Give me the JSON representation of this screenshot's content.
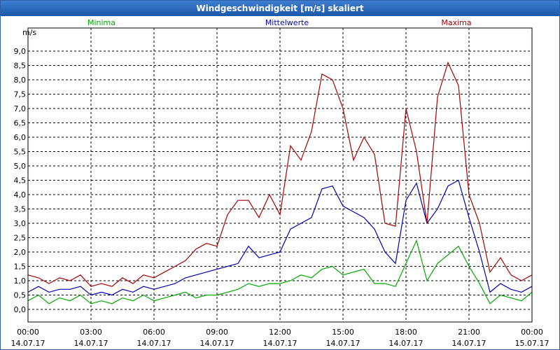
{
  "window": {
    "title": "Windgeschwindigkeit [m/s] skaliert"
  },
  "colors": {
    "Minima": "#00aa00",
    "Mittelwerte": "#0000bb",
    "Maxima": "#aa0000",
    "grid": "#000000"
  },
  "chart_data": {
    "type": "line",
    "title": "Windgeschwindigkeit [m/s] skaliert",
    "ylabel": "m/s",
    "ylim": [
      0,
      9.5
    ],
    "xlim": [
      "14.07.17 00:00",
      "15.07.17 00:00"
    ],
    "grid": true,
    "legend": "top",
    "x_ticks": [
      {
        "time": "00:00",
        "date": "14.07.17"
      },
      {
        "time": "03:00",
        "date": "14.07.17"
      },
      {
        "time": "06:00",
        "date": "14.07.17"
      },
      {
        "time": "09:00",
        "date": "14.07.17"
      },
      {
        "time": "12:00",
        "date": "14.07.17"
      },
      {
        "time": "15:00",
        "date": "14.07.17"
      },
      {
        "time": "18:00",
        "date": "14.07.17"
      },
      {
        "time": "21:00",
        "date": "14.07.17"
      },
      {
        "time": "00:00",
        "date": "15.07.17"
      }
    ],
    "y_ticks": [
      "0,0",
      "0,5",
      "1,0",
      "1,5",
      "2,0",
      "2,5",
      "3,0",
      "3,5",
      "4,0",
      "4,5",
      "5,0",
      "5,5",
      "6,0",
      "6,5",
      "7,0",
      "7,5",
      "8,0",
      "8,5",
      "9,0"
    ],
    "x_hours": [
      0,
      0.5,
      1,
      1.5,
      2,
      2.5,
      3,
      3.5,
      4,
      4.5,
      5,
      5.5,
      6,
      6.5,
      7,
      7.5,
      8,
      8.5,
      9,
      9.5,
      10,
      10.5,
      11,
      11.5,
      12,
      12.5,
      13,
      13.5,
      14,
      14.5,
      15,
      15.5,
      16,
      16.5,
      17,
      17.5,
      18,
      18.5,
      19,
      19.5,
      20,
      20.5,
      21,
      21.5,
      22,
      22.5,
      23,
      23.5,
      24
    ],
    "series": [
      {
        "name": "Minima",
        "values": [
          0.3,
          0.5,
          0.2,
          0.4,
          0.3,
          0.5,
          0.2,
          0.3,
          0.2,
          0.4,
          0.3,
          0.5,
          0.3,
          0.4,
          0.5,
          0.6,
          0.4,
          0.5,
          0.5,
          0.6,
          0.7,
          0.9,
          0.8,
          0.9,
          0.9,
          1.0,
          1.2,
          1.1,
          1.4,
          1.5,
          1.2,
          1.3,
          1.4,
          0.9,
          0.9,
          0.8,
          1.6,
          2.4,
          1.0,
          1.6,
          1.9,
          2.2,
          1.5,
          0.9,
          0.2,
          0.5,
          0.4,
          0.3,
          0.6
        ]
      },
      {
        "name": "Mittelwerte",
        "values": [
          0.6,
          0.8,
          0.6,
          0.7,
          0.7,
          0.8,
          0.5,
          0.6,
          0.5,
          0.7,
          0.6,
          0.8,
          0.7,
          0.8,
          0.9,
          1.1,
          1.2,
          1.3,
          1.4,
          1.5,
          1.6,
          2.2,
          1.8,
          1.9,
          2.0,
          2.8,
          3.0,
          3.2,
          4.2,
          4.3,
          3.6,
          3.4,
          3.2,
          2.8,
          2.0,
          1.6,
          3.8,
          4.4,
          3.0,
          3.5,
          4.3,
          4.5,
          3.2,
          2.0,
          0.6,
          0.9,
          0.7,
          0.6,
          0.8
        ]
      },
      {
        "name": "Maxima",
        "values": [
          1.2,
          1.1,
          0.9,
          1.1,
          1.0,
          1.2,
          0.8,
          0.9,
          0.8,
          1.1,
          0.9,
          1.2,
          1.1,
          1.3,
          1.5,
          1.7,
          2.1,
          2.3,
          2.2,
          3.3,
          3.8,
          3.8,
          3.2,
          4.0,
          3.3,
          5.7,
          5.2,
          6.2,
          8.2,
          8.0,
          7.0,
          5.2,
          6.0,
          5.4,
          3.0,
          2.9,
          7.0,
          5.5,
          3.0,
          7.4,
          8.6,
          7.8,
          4.0,
          3.0,
          1.3,
          1.8,
          1.2,
          1.0,
          1.2
        ]
      }
    ]
  }
}
